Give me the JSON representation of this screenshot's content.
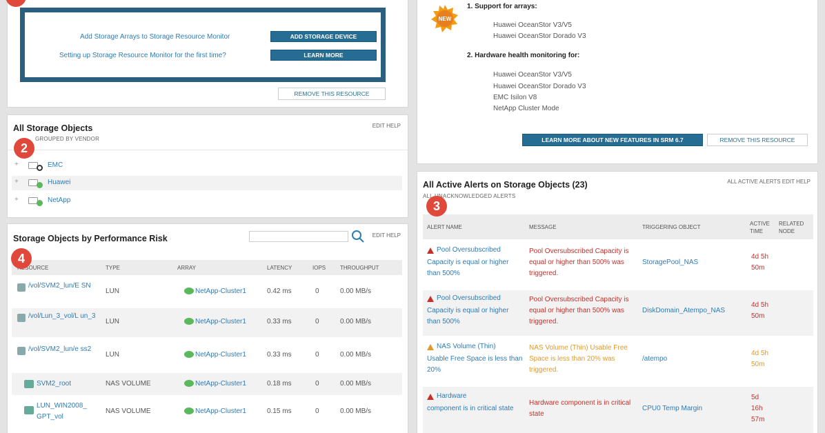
{
  "markers": {
    "m2": "2",
    "m3": "3",
    "m4": "4"
  },
  "getting_started": {
    "add_text": "Add Storage Arrays to Storage Resource Monitor",
    "add_button": "ADD STORAGE DEVICE",
    "setup_text": "Setting up Storage Resource Monitor for the first time?",
    "learn_button": "LEARN MORE",
    "remove_button": "REMOVE THIS RESOURCE"
  },
  "whats_new": {
    "new_badge": "NEW",
    "heading1": "1. Support for arrays:",
    "arrays": [
      "Huawei OceanStor V3/V5",
      "Huawei OceanStor Dorado V3"
    ],
    "heading2": "2. Hardware health monitoring for:",
    "health": [
      "Huawei OceanStor V3/V5",
      "Huawei OceanStor Dorado V3",
      "EMC Isilon V8",
      "NetApp Cluster Mode"
    ],
    "learn_button": "LEARN MORE ABOUT NEW FEATURES IN SRM 6.7",
    "remove_button": "REMOVE THIS RESOURCE"
  },
  "all_storage": {
    "title": "All Storage Objects",
    "subtitle": "GROUPED BY VENDOR",
    "links": "EDIT HELP",
    "vendors": [
      "EMC",
      "Huawei",
      "NetApp"
    ],
    "vendor_colors": [
      "#333333",
      "#5cb85c",
      "#5cb85c"
    ]
  },
  "perf_risk": {
    "title": "Storage Objects by Performance Risk",
    "links": "EDIT HELP",
    "search_placeholder": "",
    "columns": [
      "RESOURCE",
      "TYPE",
      "ARRAY",
      "LATENCY",
      "IOPS",
      "THROUGHPUT"
    ],
    "rows": [
      {
        "resource": "/vol/SVM2_lun/E SN",
        "type": "LUN",
        "array": "NetApp-Cluster1",
        "latency": "0.42 ms",
        "iops": "0",
        "throughput": "0.00 MB/s"
      },
      {
        "resource": "/vol/Lun_3_vol/L un_3",
        "type": "LUN",
        "array": "NetApp-Cluster1",
        "latency": "0.33 ms",
        "iops": "0",
        "throughput": "0.00 MB/s"
      },
      {
        "resource": "/vol/SVM2_lun/e ss2",
        "type": "LUN",
        "array": "NetApp-Cluster1",
        "latency": "0.33 ms",
        "iops": "0",
        "throughput": "0.00 MB/s"
      },
      {
        "resource": "SVM2_root",
        "type": "NAS VOLUME",
        "array": "NetApp-Cluster1",
        "latency": "0.18 ms",
        "iops": "0",
        "throughput": "0.00 MB/s"
      },
      {
        "resource": "LUN_WIN2008_ GPT_vol",
        "type": "NAS VOLUME",
        "array": "NetApp-Cluster1",
        "latency": "0.15 ms",
        "iops": "0",
        "throughput": "0.00 MB/s"
      }
    ]
  },
  "alerts": {
    "title": "All Active Alerts on Storage Objects (23)",
    "subtitle": "ALL UNACKNOWLEDGED ALERTS",
    "links": "ALL ACTIVE ALERTS  EDIT  HELP",
    "columns": [
      "ALERT NAME",
      "MESSAGE",
      "TRIGGERING OBJECT",
      "ACTIVE TIME",
      "RELATED NODE"
    ],
    "rows": [
      {
        "name": "Pool Oversubscribed",
        "desc": "Capacity is equal or higher than 500%",
        "message": "Pool Oversubscribed Capacity is equal or higher than 500% was triggered.",
        "object": "StoragePool_NAS",
        "time": "4d 5h 50m",
        "severity": "critical"
      },
      {
        "name": "Pool Oversubscribed",
        "desc": "Capacity is equal or higher than 500%",
        "message": "Pool Oversubscribed Capacity is equal or higher than 500% was triggered.",
        "object": "DiskDomain_Atempo_NAS",
        "time": "4d 5h 50m",
        "severity": "critical"
      },
      {
        "name": "NAS Volume (Thin)",
        "desc": "Usable Free Space is less than 20%",
        "message": "NAS Volume (Thin) Usable Free Space is less than 20% was triggered.",
        "object": "/atempo",
        "time": "4d 5h 50m",
        "severity": "warning"
      },
      {
        "name": "Hardware",
        "desc": "component is in critical state",
        "message": "Hardware component is in critical state",
        "object": "CPU0 Temp Margin",
        "time": "5d 16h 57m",
        "severity": "critical"
      }
    ]
  },
  "colors": {
    "accent": "#266d94",
    "critical": "#c4312b",
    "warning": "#e09a2a",
    "ok": "#5cb85c"
  }
}
